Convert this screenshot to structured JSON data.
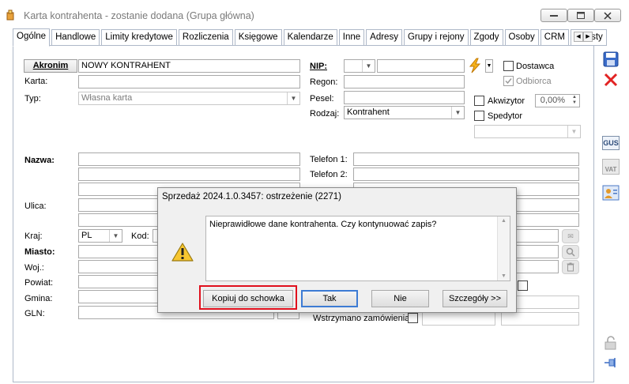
{
  "window": {
    "title": "Karta kontrahenta - zostanie dodana (Grupa główna)",
    "minimize_glyph": "▭",
    "maximize_glyph": "▢",
    "close_glyph": "✕"
  },
  "tabs": [
    "Ogólne",
    "Handlowe",
    "Limity kredytowe",
    "Rozliczenia",
    "Księgowe",
    "Kalendarze",
    "Inne",
    "Adresy",
    "Grupy i rejony",
    "Zgody",
    "Osoby",
    "CRM",
    "Upusty"
  ],
  "tab_scroll": {
    "left": "◀",
    "right": "▶"
  },
  "form": {
    "akronim_label": "Akronim",
    "akronim_value": "NOWY KONTRAHENT",
    "karta_label": "Karta:",
    "typ_label": "Typ:",
    "typ_value": "Własna karta",
    "nip_label": "NIP:",
    "regon_label": "Regon:",
    "pesel_label": "Pesel:",
    "rodzaj_label": "Rodzaj:",
    "rodzaj_value": "Kontrahent",
    "dostawca_label": "Dostawca",
    "odbiorca_label": "Odbiorca",
    "akwizytor_label": "Akwizytor",
    "akwizytor_value": "0,00%",
    "spedytor_label": "Spedytor",
    "nazwa_label": "Nazwa:",
    "ulica_label": "Ulica:",
    "kraj_label": "Kraj:",
    "kraj_value": "PL",
    "kod_label": "Kod:",
    "miasto_label": "Miasto:",
    "woj_label": "Woj.:",
    "powiat_label": "Powiat:",
    "gmina_label": "Gmina:",
    "gln_label": "GLN:",
    "telefon1_label": "Telefon 1:",
    "telefon2_label": "Telefon 2:",
    "wstrzymano_label": "Wstrzymano zamówienia"
  },
  "sidebar": {
    "gus_label": "GUS",
    "vat_label": "VAT"
  },
  "dialog": {
    "title": "Sprzedaż 2024.1.0.3457: ostrzeżenie (2271)",
    "message": "Nieprawidłowe dane kontrahenta. Czy kontynuować zapis?",
    "buttons": {
      "copy": "Kopiuj do schowka",
      "yes": "Tak",
      "no": "Nie",
      "details": "Szczegóły >>"
    }
  },
  "colors": {
    "accent_blue": "#3d7bd4",
    "highlight_red": "#e0101d",
    "tab_border": "#aeb8c8"
  }
}
